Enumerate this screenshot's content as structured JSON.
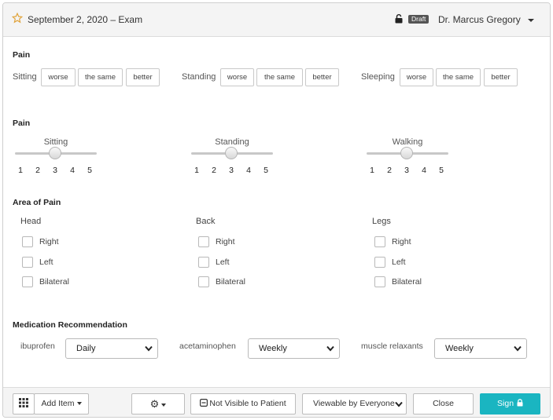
{
  "header": {
    "title": "September 2, 2020 – Exam",
    "badge": "Draft",
    "doctor": "Dr. Marcus Gregory"
  },
  "pain_compare": {
    "title": "Pain",
    "options": [
      "worse",
      "the same",
      "better"
    ],
    "groups": [
      {
        "label": "Sitting"
      },
      {
        "label": "Standing"
      },
      {
        "label": "Sleeping"
      }
    ]
  },
  "pain_scale": {
    "title": "Pain",
    "ticks": [
      "1",
      "2",
      "3",
      "4",
      "5"
    ],
    "sliders": [
      {
        "label": "Sitting",
        "value": 3
      },
      {
        "label": "Standing",
        "value": 3
      },
      {
        "label": "Walking",
        "value": 3
      }
    ]
  },
  "area_of_pain": {
    "title": "Area of Pain",
    "options": [
      "Right",
      "Left",
      "Bilateral"
    ],
    "groups": [
      {
        "label": "Head"
      },
      {
        "label": "Back"
      },
      {
        "label": "Legs"
      }
    ]
  },
  "medication": {
    "title": "Medication Recommendation",
    "items": [
      {
        "label": "ibuprofen",
        "value": "Daily"
      },
      {
        "label": "acetaminophen",
        "value": "Weekly"
      },
      {
        "label": "muscle relaxants",
        "value": "Weekly"
      }
    ]
  },
  "footer": {
    "add_item": "Add Item",
    "not_visible": "Not Visible to Patient",
    "viewable": "Viewable by Everyone",
    "close": "Close",
    "sign": "Sign"
  },
  "colors": {
    "accent": "#1ab5c1",
    "star": "#e0a33a",
    "badge": "#555555"
  }
}
